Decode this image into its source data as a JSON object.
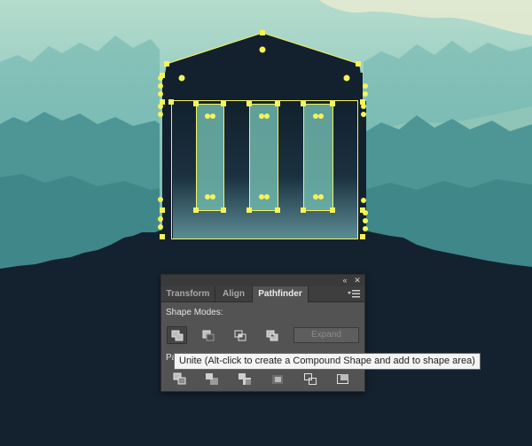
{
  "panel": {
    "tabs": [
      {
        "label": "Transform",
        "active": false
      },
      {
        "label": "Align",
        "active": false
      },
      {
        "label": "Pathfinder",
        "active": true
      }
    ],
    "shape_modes_label": "Shape Modes:",
    "shape_mode_buttons": [
      {
        "name": "unite",
        "icon": "unite-icon",
        "pressed": true
      },
      {
        "name": "minus-front",
        "icon": "minus-front-icon",
        "pressed": false
      },
      {
        "name": "intersect",
        "icon": "intersect-icon",
        "pressed": false
      },
      {
        "name": "exclude",
        "icon": "exclude-icon",
        "pressed": false
      }
    ],
    "expand_label": "Expand",
    "pathfinders_label": "Pa",
    "pathfinder_buttons": [
      {
        "name": "divide",
        "icon": "divide-icon"
      },
      {
        "name": "trim",
        "icon": "trim-icon"
      },
      {
        "name": "merge",
        "icon": "merge-icon"
      },
      {
        "name": "crop",
        "icon": "crop-icon"
      },
      {
        "name": "outline",
        "icon": "outline-icon"
      },
      {
        "name": "minus-back",
        "icon": "minus-back-icon"
      }
    ]
  },
  "tooltip": {
    "text": "Unite (Alt-click to create a Compound Shape and add to shape area)"
  },
  "colors": {
    "sky_top": "#a9d4c6",
    "sky_bottom": "#5ea9a8",
    "hill": "#14222f",
    "temple": "#13202e",
    "selection": "#f4f45a",
    "panel_bg": "#535353"
  }
}
